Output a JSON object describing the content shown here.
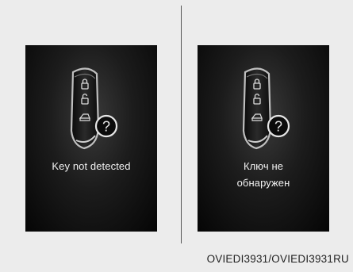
{
  "panels": [
    {
      "message_line1": "Key not detected",
      "message_line2": ""
    },
    {
      "message_line1": "Ключ не",
      "message_line2": "обнаружен"
    }
  ],
  "caption": "OVIEDI3931/OVIEDI3931RU",
  "icons": [
    "smart-key-fob-icon",
    "lock-icon",
    "unlock-icon",
    "trunk-icon",
    "question-mark-icon"
  ],
  "colors": {
    "screen": "#111111",
    "text": "#f2f2f2",
    "background": "#ececec"
  }
}
